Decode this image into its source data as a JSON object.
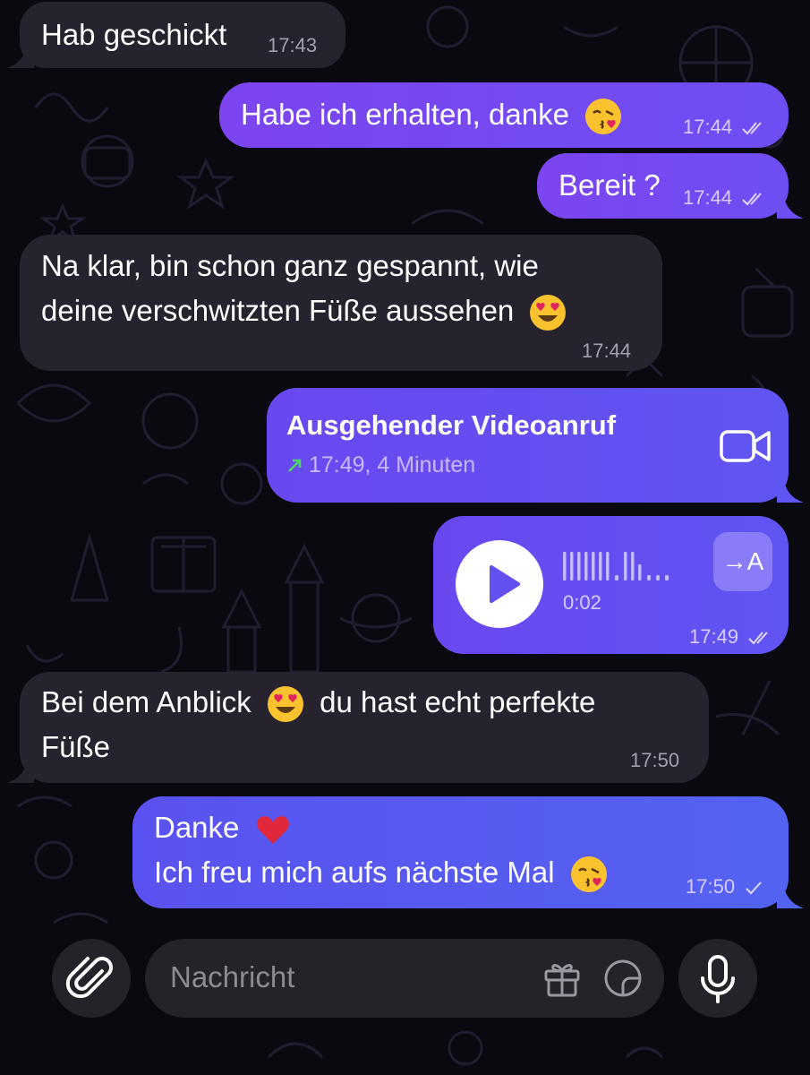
{
  "messages": [
    {
      "id": "m1",
      "dir": "in",
      "text": "Hab geschickt",
      "time": "17:43"
    },
    {
      "id": "m2",
      "dir": "out",
      "text": "Habe ich erhalten, danke",
      "emoji": "kissing-face-emoji",
      "time": "17:44",
      "status": "read"
    },
    {
      "id": "m3",
      "dir": "out",
      "text": "Bereit ?",
      "time": "17:44",
      "status": "read"
    },
    {
      "id": "m4",
      "dir": "in",
      "lines": [
        "Na klar, bin schon ganz gespannt, wie",
        "deine verschwitzten Füße aussehen"
      ],
      "emoji": "heart-eyes-emoji",
      "time": "17:44"
    },
    {
      "id": "m5",
      "dir": "out",
      "type": "call",
      "title": "Ausgehender Videoanruf",
      "sub": "17:49, 4 Minuten",
      "icon": "video-camera-icon"
    },
    {
      "id": "m6",
      "dir": "out",
      "type": "voice",
      "waveform": "lllllll.ll...",
      "duration": "0:02",
      "translate": "→A",
      "time": "17:49",
      "status": "read"
    },
    {
      "id": "m7",
      "dir": "in",
      "lines": [
        "Bei dem Anblick",
        "du hast echt perfekte",
        "Füße"
      ],
      "emoji": "heart-eyes-emoji",
      "time": "17:50"
    },
    {
      "id": "m8",
      "dir": "out",
      "lines": [
        "Danke",
        "Ich freu mich aufs nächste Mal"
      ],
      "emoji": [
        "red-heart-emoji",
        "kissing-face-emoji"
      ],
      "time": "17:50",
      "status": "sent"
    }
  ],
  "composer": {
    "placeholder": "Nachricht",
    "attach_icon": "paperclip-icon",
    "gift_icon": "gift-icon",
    "sticker_icon": "sticker-icon",
    "mic_icon": "microphone-icon"
  },
  "colors": {
    "incoming": "#26232e",
    "outgoing": "#7c45f0",
    "outgoing_late": "#5463f2",
    "background": "#0a0910"
  }
}
